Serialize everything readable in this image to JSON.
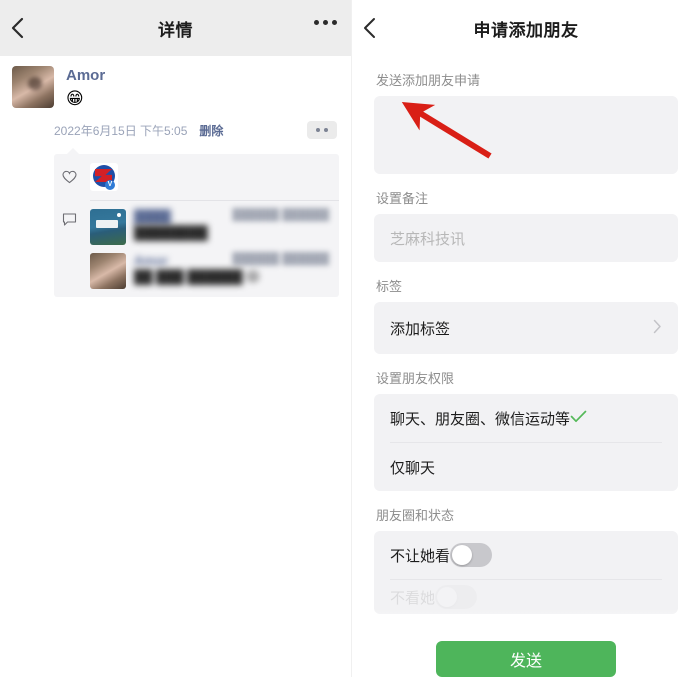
{
  "left_panel": {
    "nav": {
      "back_icon": "back-chevron-icon",
      "title": "详情",
      "more_icon": "more-dots-icon"
    },
    "post": {
      "author": "Amor",
      "content_emoji": "😁",
      "timestamp": "2022年6月15日 下午5:05",
      "delete_label": "删除",
      "action_icon": "two-dots-action-icon",
      "avatar_icon": "avatar-photo"
    },
    "interaction": {
      "like_icon": "heart-icon",
      "like_thumbnail": {
        "badge_letter": "V",
        "name": "liked-account-logo"
      },
      "comment_icon": "comment-bubble-icon",
      "comments": [
        {
          "author": "████",
          "date": "██████ ██████",
          "text": "████████",
          "thumb": "comment-avatar-1"
        },
        {
          "author": "Amor",
          "date": "██████ ██████",
          "text": "██ ███ ██████",
          "emoji": "😄",
          "thumb": "comment-avatar-2"
        }
      ]
    }
  },
  "right_panel": {
    "nav": {
      "back_icon": "back-chevron-icon",
      "title": "申请添加朋友"
    },
    "request": {
      "label": "发送添加朋友申请",
      "value": "",
      "placeholder": ""
    },
    "remark": {
      "label": "设置备注",
      "value": "",
      "placeholder": "芝麻科技讯"
    },
    "tags": {
      "label": "标签",
      "action_label": "添加标签",
      "chevron_icon": "chevron-right-icon"
    },
    "permissions": {
      "label": "设置朋友权限",
      "options": [
        {
          "label": "聊天、朋友圈、微信运动等",
          "selected": true,
          "check_icon": "check-icon"
        },
        {
          "label": "仅聊天",
          "selected": false
        }
      ]
    },
    "moments": {
      "label": "朋友圈和状态",
      "rows": [
        {
          "label": "不让她看",
          "toggle": "off"
        },
        {
          "label": "不看她",
          "toggle": "off"
        }
      ]
    },
    "send_button": "发送",
    "accent_color": "#4eb55b"
  },
  "annotation": {
    "arrow_icon": "red-arrow-annotation",
    "color": "#d91f16"
  }
}
